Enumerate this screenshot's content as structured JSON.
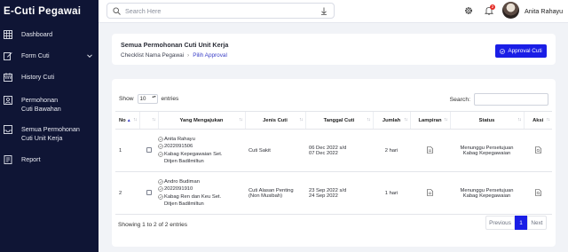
{
  "app": {
    "title": "E-Cuti Pegawai"
  },
  "sidebar": {
    "items": [
      {
        "label": "Dashboard",
        "icon": "grid-icon"
      },
      {
        "label": "Form Cuti",
        "icon": "edit-icon",
        "has_submenu": true
      },
      {
        "label": "History Cuti",
        "icon": "calendar-icon"
      },
      {
        "label_line1": "Permohonan",
        "label_line2": "Cuti Bawahan",
        "icon": "id-card-icon"
      },
      {
        "label_line1": "Semua Permohonan",
        "label_line2": "Cuti Unit Kerja",
        "icon": "inbox-icon"
      },
      {
        "label": "Report",
        "icon": "report-icon"
      }
    ]
  },
  "topbar": {
    "search_placeholder": "Search Here",
    "notification_count": "2",
    "user_name": "Anita Rahayu"
  },
  "header": {
    "title": "Semua Permohonan Cuti Unit Kerja",
    "breadcrumb": [
      "Checklist Nama Pegawai",
      "Pilih Approval"
    ],
    "approve_button": "Approval Cuti"
  },
  "table_controls": {
    "show_label": "Show",
    "entries_value": "10",
    "entries_label": "entries",
    "search_label": "Search:"
  },
  "table": {
    "columns": [
      "No",
      "",
      "Yang Mengajukan",
      "Jenis Cuti",
      "Tanggal Cuti",
      "Jumlah",
      "Lampiran",
      "Status",
      "Aksi"
    ],
    "rows": [
      {
        "no": "1",
        "name": "Anita Rahayu",
        "nip": "2022091506",
        "position_line1": "Kabag Kepegawaian Set.",
        "position_line2": "Ditjen Badilmiltun",
        "leave_type_line1": "Cuti Sakit",
        "leave_type_line2": "",
        "date_line1": "06 Dec 2022 s/d",
        "date_line2": "07 Dec 2022",
        "amount": "2 hari",
        "status_line1": "Menunggu Persetujuan",
        "status_line2": "Kabag Kepegawaian"
      },
      {
        "no": "2",
        "name": "Andro Budiman",
        "nip": "2022091910",
        "position_line1": "Kabag Ren dan Keu Set.",
        "position_line2": "Ditjen Badilmiltun",
        "leave_type_line1": "Cuti Alasan Penting",
        "leave_type_line2": "(Non Musibah)",
        "date_line1": "23 Sep 2022 s/d",
        "date_line2": "24 Sep 2022",
        "amount": "1 hari",
        "status_line1": "Menunggu Persetujuan",
        "status_line2": "Kabag Kepegawaian"
      }
    ]
  },
  "footer": {
    "info": "Showing 1 to 2 of 2 entries",
    "previous": "Previous",
    "current_page": "1",
    "next": "Next"
  },
  "colors": {
    "sidebar_bg": "#0f1535",
    "accent": "#1a1ee6",
    "badge": "#e52d27"
  }
}
